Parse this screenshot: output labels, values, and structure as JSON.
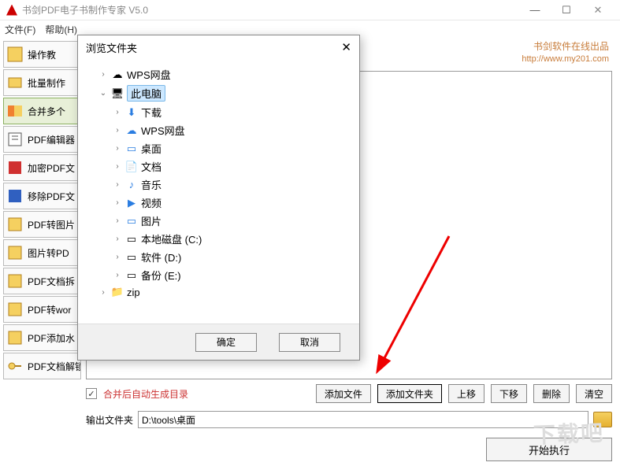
{
  "titlebar": {
    "title": "书剑PDF电子书制作专家 V5.0"
  },
  "menu": {
    "file": "文件(F)",
    "help": "帮助(H)"
  },
  "sidebar": {
    "items": [
      {
        "label": "操作教"
      },
      {
        "label": "批量制作"
      },
      {
        "label": "合并多个"
      },
      {
        "label": "PDF编辑器"
      },
      {
        "label": "加密PDF文"
      },
      {
        "label": "移除PDF文"
      },
      {
        "label": "PDF转图片"
      },
      {
        "label": "图片转PD"
      },
      {
        "label": "PDF文档拆"
      },
      {
        "label": "PDF转wor"
      },
      {
        "label": "PDF添加水"
      },
      {
        "label": "PDF文档解锁"
      }
    ]
  },
  "brand": {
    "text": "书剑软件在线出品",
    "url": "http://www.my201.com"
  },
  "controls": {
    "auto_toc": "合并后自动生成目录",
    "add_file": "添加文件",
    "add_folder": "添加文件夹",
    "move_up": "上移",
    "move_down": "下移",
    "delete": "删除",
    "clear": "清空",
    "output_label": "输出文件夹",
    "output_value": "D:\\tools\\桌面",
    "start": "开始执行"
  },
  "dialog": {
    "title": "浏览文件夹",
    "ok": "确定",
    "cancel": "取消",
    "tree": {
      "wps": "WPS网盘",
      "pc": "此电脑",
      "downloads": "下载",
      "wps2": "WPS网盘",
      "desktop": "桌面",
      "documents": "文档",
      "music": "音乐",
      "videos": "视频",
      "pictures": "图片",
      "cdrive": "本地磁盘 (C:)",
      "ddrive": "软件 (D:)",
      "edrive": "备份 (E:)",
      "zip": "zip"
    }
  },
  "watermark": "下载吧"
}
